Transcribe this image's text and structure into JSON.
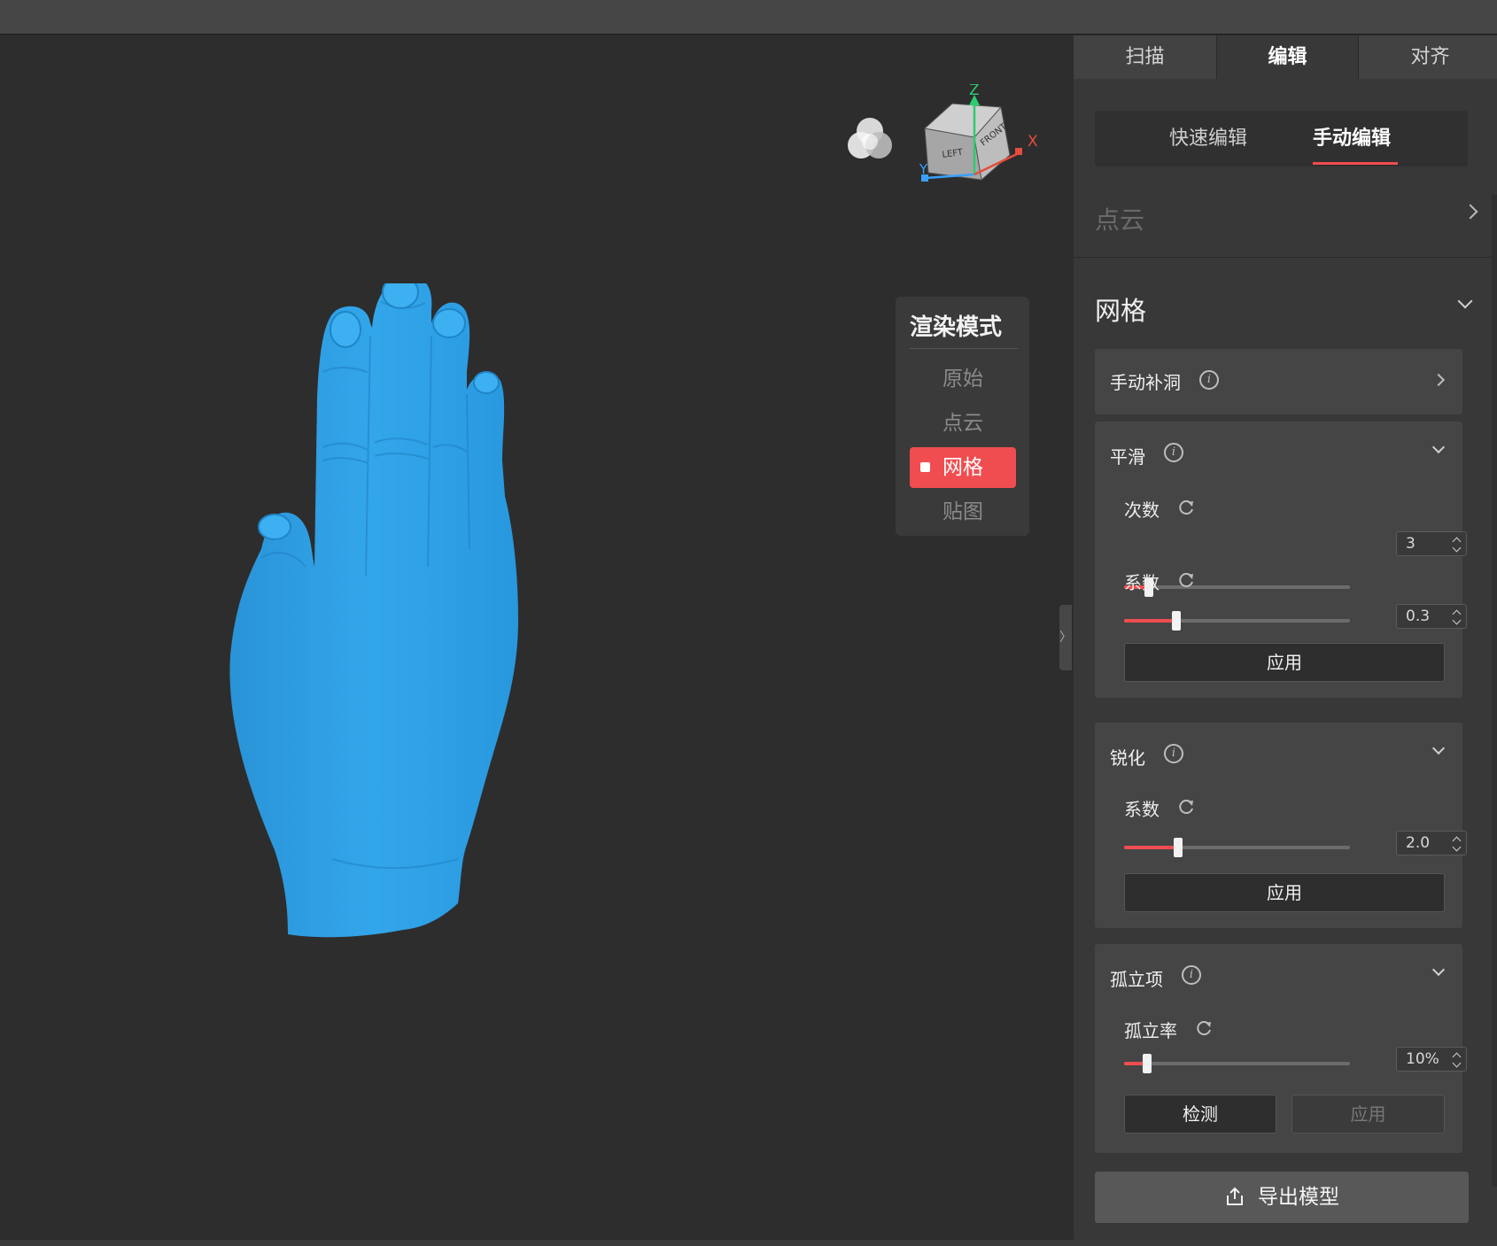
{
  "app": {
    "tabs": [
      {
        "label": "扫描",
        "active": false
      },
      {
        "label": "编辑",
        "active": true
      },
      {
        "label": "对齐",
        "active": false
      }
    ],
    "subtabs": [
      {
        "label": "快速编辑",
        "active": false
      },
      {
        "label": "手动编辑",
        "active": true
      }
    ]
  },
  "viewport": {
    "model_color": "#33a6ea",
    "gizmo": {
      "axis_z": "Z",
      "axis_x": "X",
      "axis_y": "Y",
      "face_left": "LEFT",
      "face_front": "FRONT"
    }
  },
  "render_mode": {
    "title": "渲染模式",
    "items": [
      {
        "label": "原始",
        "active": false
      },
      {
        "label": "点云",
        "active": false
      },
      {
        "label": "网格",
        "active": true
      },
      {
        "label": "贴图",
        "active": false
      }
    ]
  },
  "panel": {
    "point_cloud": {
      "label": "点云"
    },
    "mesh": {
      "label": "网格",
      "manual_fill": {
        "label": "手动补洞"
      },
      "smooth": {
        "label": "平滑",
        "count": {
          "label": "次数",
          "value": "3",
          "fraction": 0.11
        },
        "factor": {
          "label": "系数",
          "value": "0.3",
          "fraction": 0.23
        },
        "apply_label": "应用"
      },
      "sharpen": {
        "label": "锐化",
        "factor": {
          "label": "系数",
          "value": "2.0",
          "fraction": 0.24
        },
        "apply_label": "应用"
      },
      "isolated": {
        "label": "孤立项",
        "rate": {
          "label": "孤立率",
          "value": "10%",
          "fraction": 0.1
        },
        "detect_label": "检测",
        "apply_label": "应用"
      }
    },
    "export_label": "导出模型"
  },
  "colors": {
    "accent": "#f04d50",
    "panel_bg": "#383838",
    "viewport_bg": "#2d2d2d"
  }
}
